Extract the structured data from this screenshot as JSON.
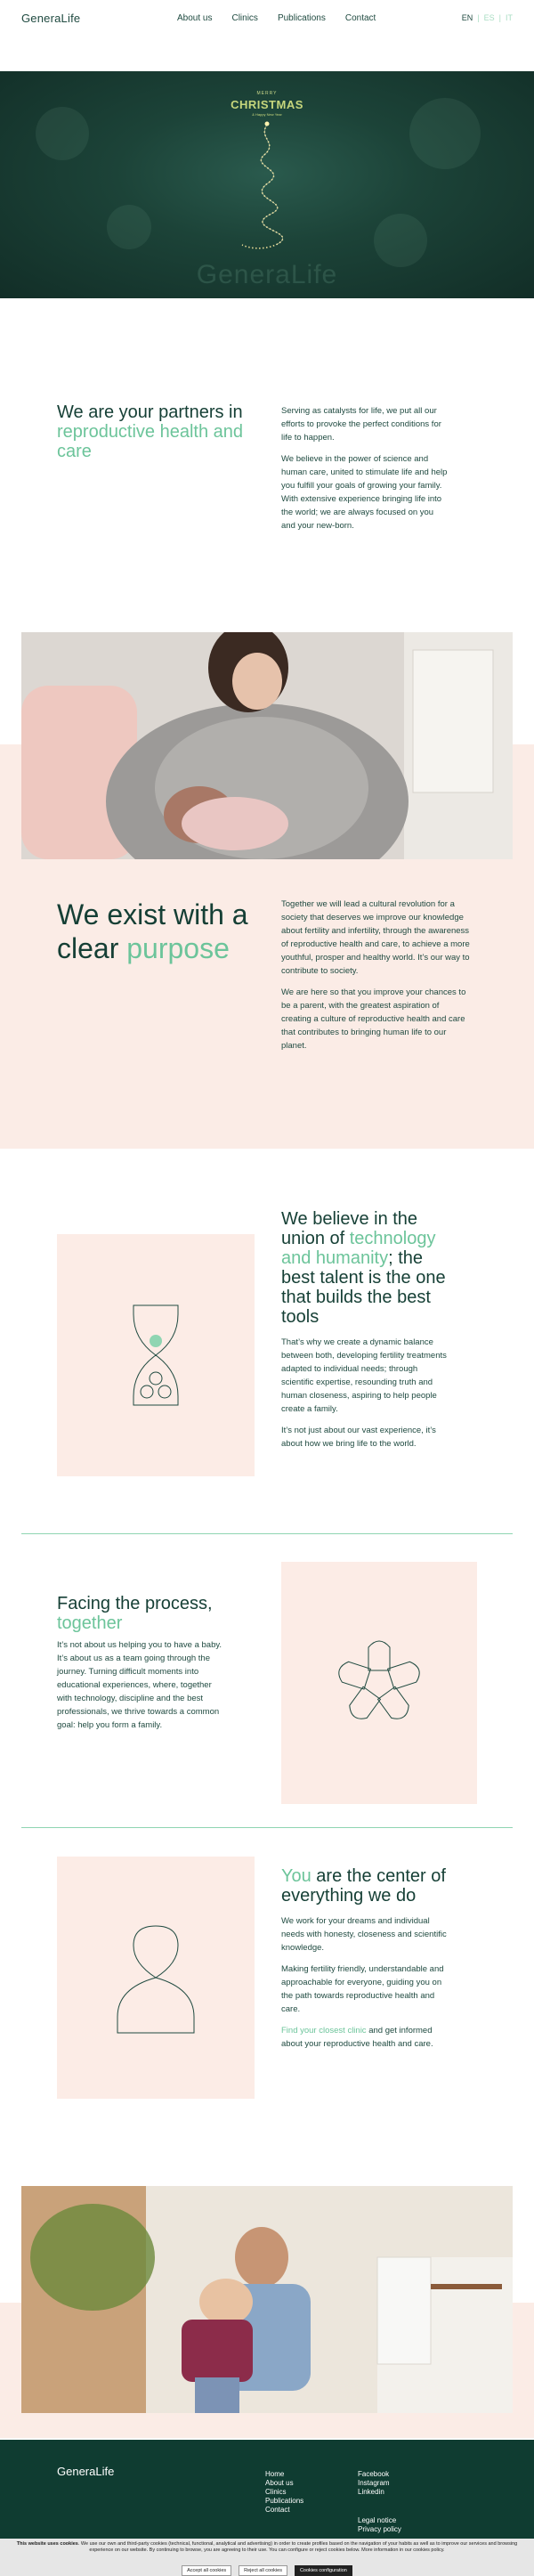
{
  "header": {
    "logo": "GeneraLife",
    "nav": [
      "About us",
      "Clinics",
      "Publications",
      "Contact"
    ],
    "lang": {
      "active": "EN",
      "others": [
        "ES",
        "IT"
      ]
    }
  },
  "hero": {
    "kicker": "MERRY",
    "title": "CHRISTMAS",
    "subtitle": "& Happy New Year",
    "brand": "GeneraLife"
  },
  "section1": {
    "title_a": "We are your partners in ",
    "title_b": "reproductive health and care",
    "p1": "Serving as catalysts for life, we put all our efforts to provoke the perfect conditions for life to happen.",
    "p2": "We believe in the power of science and human care, united to stimulate life and help you fulfill your goals of growing your family. With extensive experience bringing life into the world; we are always focused on you and your new-born."
  },
  "section2": {
    "title_a": "We exist with a clear ",
    "title_b": "purpose",
    "p1": "Together we will lead a cultural revolution for a society that deserves we improve our knowledge about fertility and infertility, through the awareness of reproductive health and care, to achieve a more youthful, prosper and healthy world. It’s our way to contribute to society.",
    "p2": "We are here so that you improve your chances to be a parent, with the greatest aspiration of creating a culture of reproductive health and care that contributes to bringing human life to our planet."
  },
  "section3": {
    "title_a": "We believe in the union of ",
    "title_b": "technology and humanity",
    "title_c": "; the best talent is the one that builds the best tools",
    "p1": "That’s why we create a dynamic balance between both, developing fertility treatments adapted to individual needs; through scientific expertise, resounding truth and human closeness, aspiring to help people create a family.",
    "p2": "It’s not just about our vast experience, it’s about how we bring life to the world."
  },
  "section4": {
    "title_a": "Facing the process, ",
    "title_b": "together",
    "p1": "It’s not about us helping you to have a baby. It’s about us as a team going through the journey. Turning difficult moments into educational experiences, where, together with technology, discipline and the best professionals, we thrive towards a common goal: help you form a family."
  },
  "section5": {
    "title_a": "You",
    "title_b": " are the center of everything we do",
    "p1": "We work for your dreams and individual needs with honesty, closeness and scientific knowledge.",
    "p2": "Making fertility friendly, understandable and approachable for everyone, guiding you on the path towards reproductive health and care.",
    "link": "Find your closest clinic",
    "p3_rest": " and get informed about your reproductive health and care."
  },
  "footer": {
    "logo": "GeneraLife",
    "col1": [
      "Home",
      "About us",
      "Clinics",
      "Publications",
      "Contact"
    ],
    "col2": [
      "Facebook",
      "Instagram",
      "Linkedin"
    ],
    "col3": [
      "Legal notice",
      "Privacy policy"
    ]
  },
  "cookie": {
    "text_bold": "This website uses cookies",
    "text": ". We use our own and third-party cookies (technical, functional, analytical and advertising) in order to create profiles based on the navigation of your habits as well as to improve our services and browsing experience on our website. By continuing to browse, you are agreeing to their use. You can configure or reject cookies below. More information in our cookies policy.",
    "accept": "Accept all cookies",
    "reject": "Reject all cookies",
    "configure": "Cookies configuration"
  },
  "colors": {
    "accent": "#6cc49a",
    "dark": "#153f35",
    "blush": "#fbece6",
    "footer": "#0f3c31"
  }
}
